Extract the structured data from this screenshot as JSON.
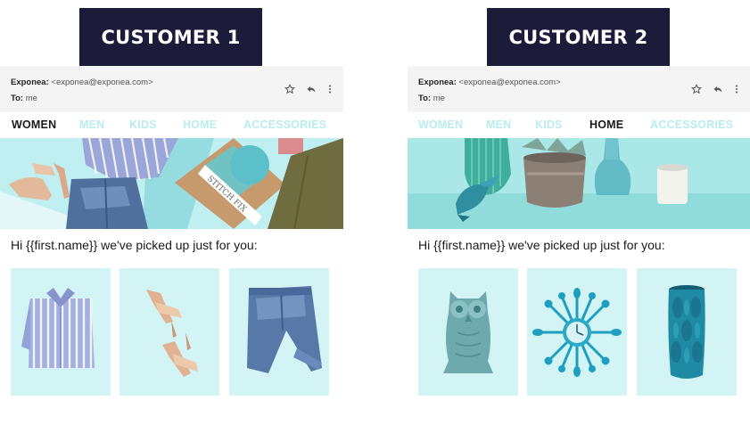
{
  "customer1": {
    "badge": "CUSTOMER 1",
    "email": {
      "from_label": "Exponea:",
      "from_value": "<exponea@exponea.com>",
      "to_label": "To:",
      "to_value": "me",
      "icons": [
        "star-icon",
        "reply-icon",
        "more-vertical-icon"
      ]
    },
    "nav": [
      {
        "label": "WOMEN",
        "active": true
      },
      {
        "label": "MEN",
        "active": false
      },
      {
        "label": "KIDS",
        "active": false
      },
      {
        "label": "HOME",
        "active": false
      },
      {
        "label": "ACCESSORIES",
        "active": false
      }
    ],
    "banner_text": "STITCH FIX",
    "greeting": "Hi {{first.name}} we've picked up just for you:",
    "products": [
      "striped-shirt",
      "sandals",
      "jeans"
    ]
  },
  "customer2": {
    "badge": "CUSTOMER 2",
    "email": {
      "from_label": "Exponea:",
      "from_value": "<exponea@exponea.com>",
      "to_label": "To:",
      "to_value": "me",
      "icons": [
        "star-icon",
        "reply-icon",
        "more-vertical-icon"
      ]
    },
    "nav": [
      {
        "label": "WOMEN",
        "active": false
      },
      {
        "label": "MEN",
        "active": false
      },
      {
        "label": "KIDS",
        "active": false
      },
      {
        "label": "HOME",
        "active": true
      },
      {
        "label": "ACCESSORIES",
        "active": false
      }
    ],
    "greeting": "Hi {{first.name}} we've picked up just for you:",
    "products": [
      "owl-figurine",
      "spoon-clock",
      "teal-vase"
    ]
  },
  "colors": {
    "badge_bg": "#1d1b3a",
    "nav_active": "#1a1a1a",
    "nav_inactive": "#b9ecee",
    "tile_bg": "#d3f4f5",
    "header_bg": "#f4f4f4"
  }
}
